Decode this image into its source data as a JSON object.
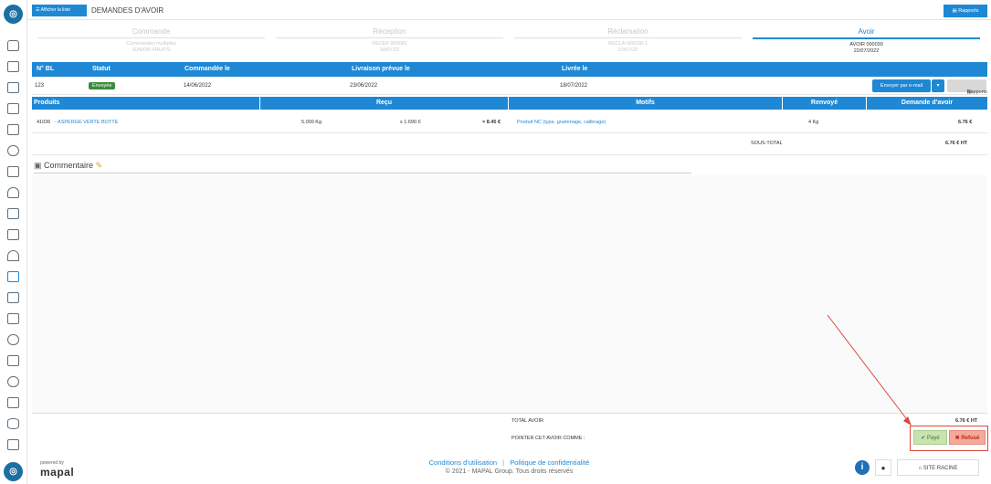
{
  "topbar": {
    "list_button": "Afficher la liste",
    "title": "DEMANDES D'AVOIR",
    "rapports": "Rapports"
  },
  "steps": [
    {
      "label": "Commande",
      "sub1": "Commandes multiples",
      "sub2": "JUNIOR FRUITS",
      "active": false
    },
    {
      "label": "Réception",
      "sub1": "RECEP 000081",
      "sub2": "18/07/22",
      "active": false
    },
    {
      "label": "Réclamation",
      "sub1": "RECLA 000036-1",
      "sub2": "22/07/22",
      "active": false
    },
    {
      "label": "Avoir",
      "sub1": "AVOIR 000030",
      "sub2": "22/07/2022",
      "active": true
    }
  ],
  "bl_table": {
    "headers": [
      "N° BL",
      "Statut",
      "Commandée le",
      "Livraison prévue le",
      "Livrée le"
    ],
    "row": {
      "bl": "123",
      "statut": "Envoyée",
      "commandee": "14/06/2022",
      "prevue": "23/06/2022",
      "livree": "18/07/2022"
    },
    "email_button": "Envoyer par e-mail",
    "caret": "▾",
    "rapports_button": "Rapports"
  },
  "products_table": {
    "headers": [
      "Produits",
      "Reçu",
      "Motifs",
      "Renvoyé",
      "Demande d'avoir"
    ],
    "row": {
      "code": "41036",
      "name": "- ASPERGE VERTE BOTTE",
      "qty": "5.000 Kg",
      "unit_price": "x 1.690 €",
      "total": "= 8.45 €",
      "motif": "Produit NC (type, grammage, calibrage)",
      "renvoye": "4  Kg",
      "demande": "6.76 €"
    },
    "subtotal_label": "SOUS-TOTAL",
    "subtotal_value": "6.76 € HT"
  },
  "comment": {
    "label": "Commentaire"
  },
  "footer": {
    "total_label": "TOTAL AVOIR",
    "total_value": "6.76 € HT",
    "pointer_label": "POINTER CET AVOIR COMME :",
    "paye": "Payé",
    "refuse": "Refusé"
  },
  "page_footer": {
    "powered": "powered by",
    "brand": "mapal",
    "conditions": "Conditions d'utilisation",
    "separator": "|",
    "privacy": "Politique de confidentialité",
    "copyright": "© 2021 - MAPAL Group. Tous droits réservés",
    "site": "SITE RACINE"
  },
  "colors": {
    "accent": "#1e88d4",
    "success": "#3c8a3c",
    "danger": "#d94a3d"
  }
}
